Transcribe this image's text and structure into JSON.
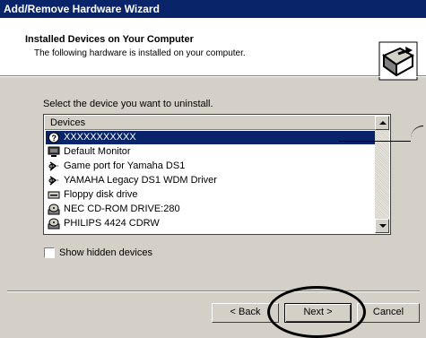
{
  "window": {
    "title": "Add/Remove Hardware Wizard"
  },
  "header": {
    "title": "Installed Devices on Your Computer",
    "subtitle": "The following hardware is installed on your computer."
  },
  "instruction": "Select the device you want to uninstall.",
  "device_list": {
    "column_header": "Devices",
    "items": [
      {
        "label": "XXXXXXXXXXX",
        "icon": "question-device-icon",
        "selected": true
      },
      {
        "label": "Default Monitor",
        "icon": "monitor-icon",
        "selected": false
      },
      {
        "label": "Game port for Yamaha DS1",
        "icon": "joystick-icon",
        "selected": false
      },
      {
        "label": "YAMAHA Legacy DS1 WDM Driver",
        "icon": "joystick-icon",
        "selected": false
      },
      {
        "label": "Floppy disk drive",
        "icon": "floppy-drive-icon",
        "selected": false
      },
      {
        "label": "NEC CD-ROM DRIVE:280",
        "icon": "cdrom-icon",
        "selected": false
      },
      {
        "label": "PHILIPS 4424 CDRW",
        "icon": "cdrom-icon",
        "selected": false
      }
    ]
  },
  "options": {
    "show_hidden_label": "Show hidden devices",
    "show_hidden_checked": false
  },
  "buttons": {
    "back": "< Back",
    "next": "Next >",
    "cancel": "Cancel"
  },
  "colors": {
    "selection": "#0a246a",
    "dialog_bg": "#d4d0c8",
    "title_bar": "#0a246a"
  }
}
